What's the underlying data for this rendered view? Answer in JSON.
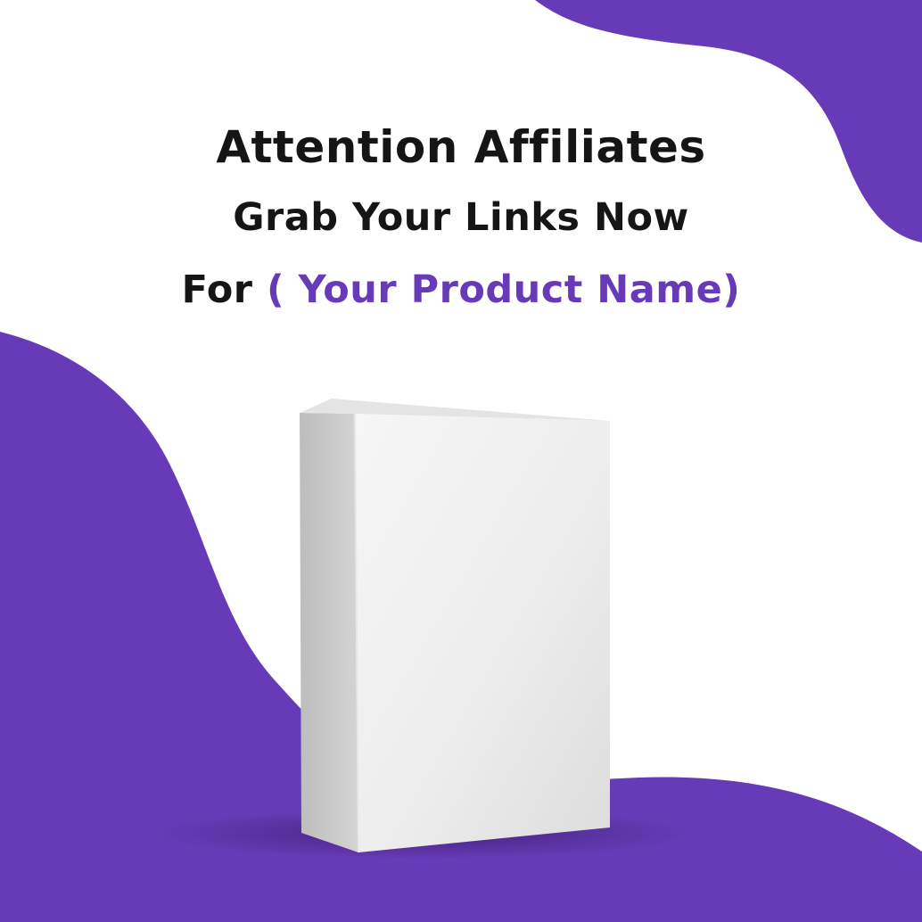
{
  "headline": {
    "line1": "Attention Affiliates",
    "line2": "Grab Your Links Now",
    "line3_prefix": "For",
    "line3_product": "( Your Product Name)"
  },
  "colors": {
    "accent": "#673AB7",
    "text": "#151515",
    "background": "#FFFFFF",
    "box_face": "#F0F0F0",
    "box_side": "#C8C8C8"
  },
  "image": {
    "subject": "blank-product-box"
  }
}
